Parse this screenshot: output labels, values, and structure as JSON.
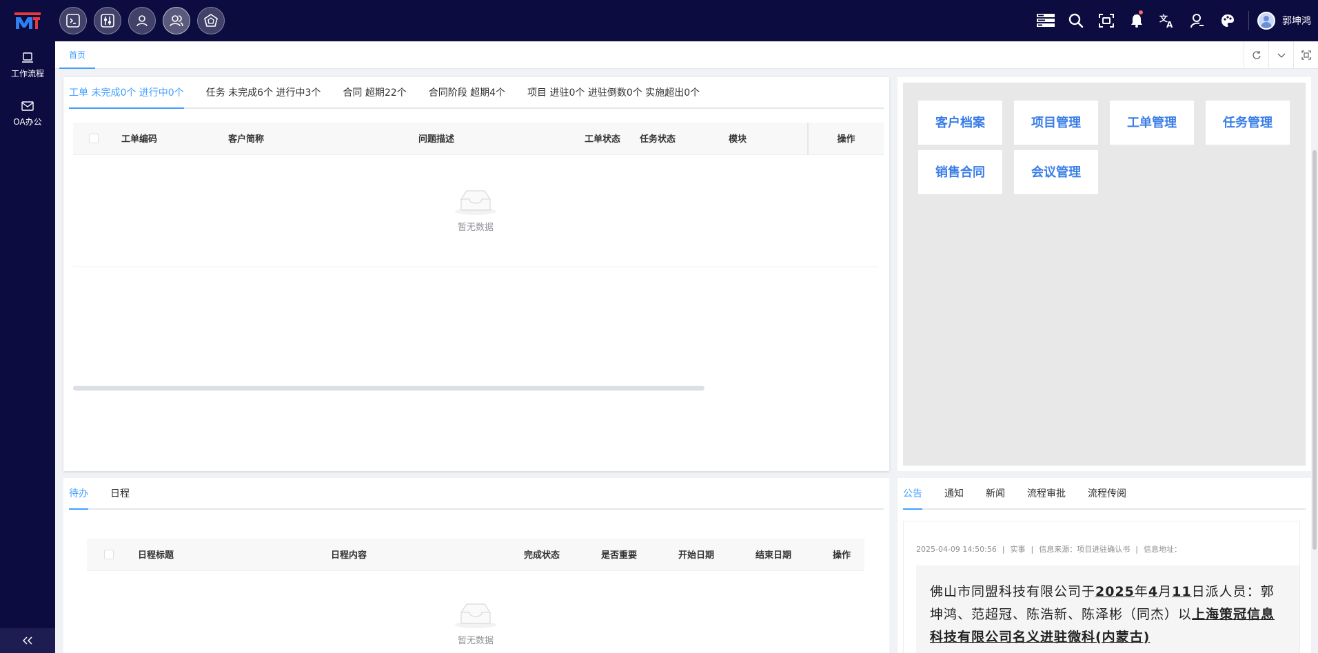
{
  "user": {
    "name": "郭坤鸿"
  },
  "sidebar": {
    "items": [
      {
        "label": "工作流程"
      },
      {
        "label": "OA办公"
      }
    ]
  },
  "tabstrip": {
    "home": "首页"
  },
  "work_panel": {
    "tabs": [
      "工单 未完成0个 进行中0个",
      "任务 未完成6个 进行中3个",
      "合同 超期22个",
      "合同阶段 超期4个",
      "项目 进驻0个 进驻倒数0个 实施超出0个"
    ],
    "columns": [
      "工单编码",
      "客户简称",
      "问题描述",
      "工单状态",
      "任务状态",
      "模块",
      "操作"
    ],
    "empty_text": "暂无数据"
  },
  "quick_links": [
    "客户档案",
    "项目管理",
    "工单管理",
    "任务管理",
    "销售合同",
    "会议管理"
  ],
  "todo_panel": {
    "tabs": [
      "待办",
      "日程"
    ],
    "columns": [
      "日程标题",
      "日程内容",
      "完成状态",
      "是否重要",
      "开始日期",
      "结束日期",
      "操作"
    ],
    "empty_text": "暂无数据"
  },
  "notice_panel": {
    "tabs": [
      "公告",
      "通知",
      "新闻",
      "流程审批",
      "流程传阅"
    ],
    "meta": {
      "datetime": "2025-04-09 14:50:56",
      "type": "实事",
      "source": "信息来源：项目进驻确认书",
      "address": "信息地址："
    },
    "body": {
      "prefix": "佛山市同盟科技有限公司于",
      "year": "2025",
      "year_unit": "年",
      "month": "4",
      "month_unit": "月",
      "day": "11",
      "day_suffix": "日派人员：郭坤鸿、范超冠、陈浩新、陈泽彬（同杰）以",
      "company": "上海策冠信息科技有限公司名义进驻微科(内蒙古)"
    }
  },
  "colors": {
    "topbar": "#0c0c40",
    "accent": "#409eff",
    "quick_link": "#3a7ee8"
  }
}
